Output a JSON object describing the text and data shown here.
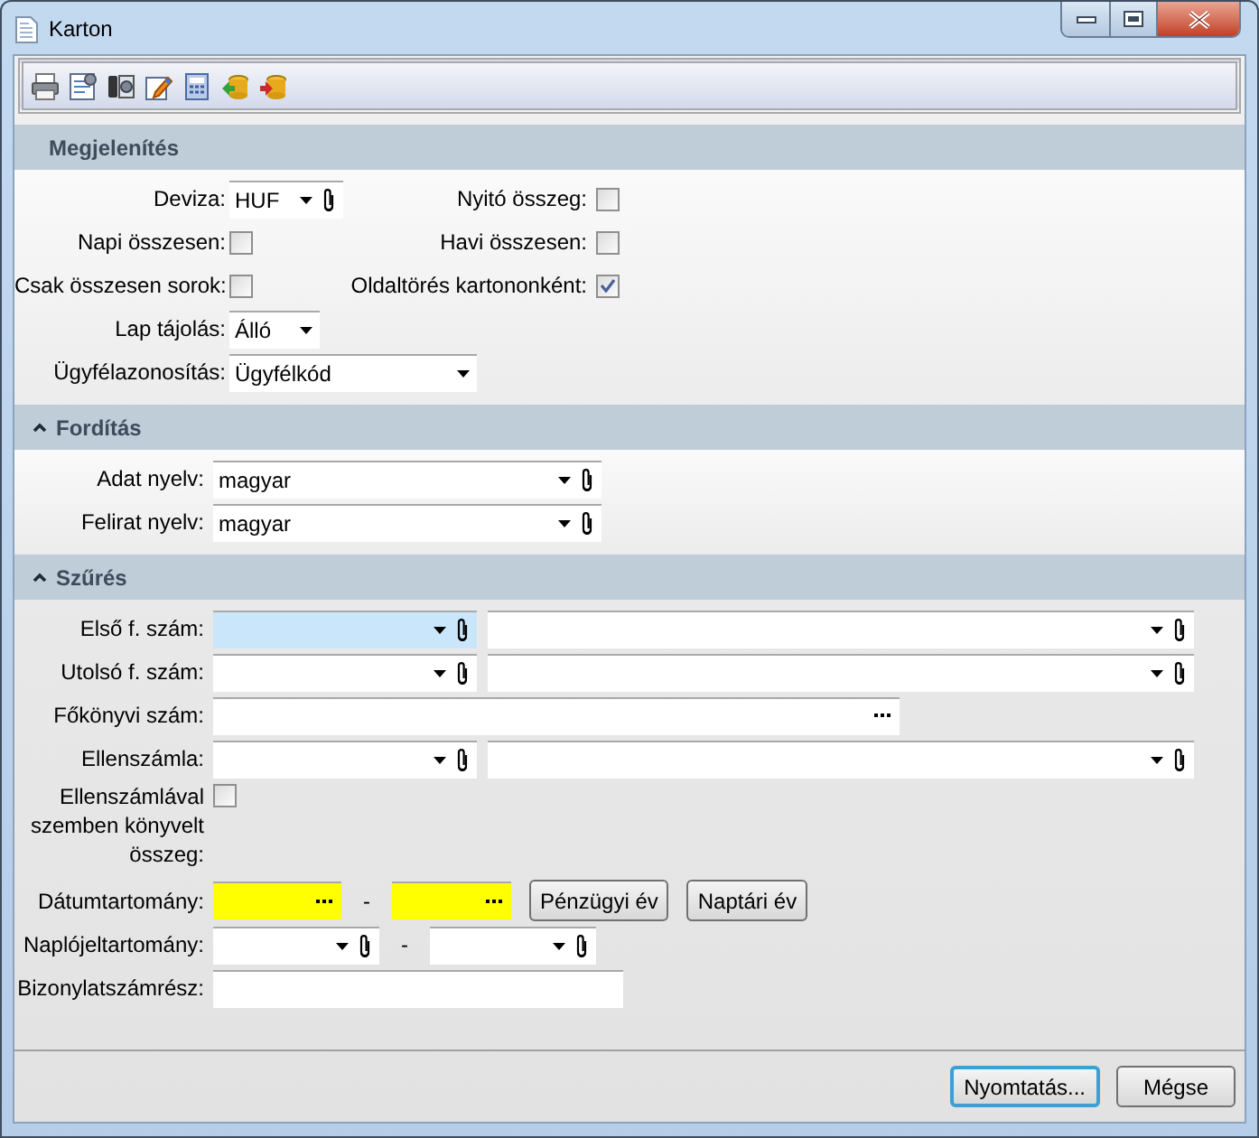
{
  "window": {
    "title": "Karton"
  },
  "sections": [
    {
      "title": "Megjelenítés",
      "collapsible": false,
      "rows": [
        [
          {
            "kind": "combo",
            "label": "Deviza:",
            "value": "HUF"
          },
          {
            "kind": "check",
            "label": "Nyitó összeg:",
            "checked": false
          }
        ],
        [
          {
            "kind": "check",
            "label": "Napi összesen:",
            "checked": false
          },
          {
            "kind": "check",
            "label": "Havi összesen:",
            "checked": false
          }
        ],
        [
          {
            "kind": "check",
            "label": "Csak összesen sorok:",
            "checked": false
          },
          {
            "kind": "check",
            "label": "Oldaltörés kartononként:",
            "checked": true
          }
        ],
        [
          {
            "kind": "select",
            "label": "Lap tájolás:",
            "value": "Álló"
          }
        ],
        [
          {
            "kind": "select",
            "label": "Ügyfélazonosítás:",
            "value": "Ügyfélkód"
          }
        ]
      ]
    },
    {
      "title": "Fordítás",
      "collapsible": true,
      "expanded": true,
      "rows": [
        {
          "label": "Adat nyelv:",
          "fields": [
            {
              "kind": "combo",
              "value": "magyar"
            }
          ]
        },
        {
          "label": "Felirat nyelv:",
          "fields": [
            {
              "kind": "combo",
              "value": "magyar"
            }
          ]
        }
      ]
    },
    {
      "title": "Szűrés",
      "collapsible": true,
      "expanded": true,
      "rows": [
        {
          "label": "Első f. szám:",
          "fields": [
            {
              "kind": "combo",
              "focused": true
            },
            {
              "kind": "combo",
              "focused": false
            }
          ]
        },
        {
          "label": "Utolsó f. szám:",
          "fields": [
            {
              "kind": "combo",
              "focused": false
            },
            {
              "kind": "combo",
              "focused": false
            }
          ]
        },
        {
          "label": "Főkönyvi szám:",
          "fields": [
            {
              "kind": "lookup"
            }
          ]
        },
        {
          "label": "Ellenszámla:",
          "fields": [
            {
              "kind": "combo",
              "focused": false
            },
            {
              "kind": "combo",
              "focused": false
            }
          ]
        },
        {
          "label": "Ellenszámlával szemben könyvelt összeg:",
          "fields": [
            {
              "kind": "check",
              "checked": false
            }
          ]
        },
        {
          "label": "Dátumtartomány:",
          "fields": [
            {
              "kind": "date",
              "required": true
            },
            {
              "kind": "dash",
              "text": "-"
            },
            {
              "kind": "date",
              "required": true
            },
            {
              "kind": "button",
              "label": "Pénzügyi év"
            },
            {
              "kind": "button",
              "label": "Naptári év"
            }
          ]
        },
        {
          "label": "Naplójeltartomány:",
          "fields": [
            {
              "kind": "combo",
              "focused": false
            },
            {
              "kind": "dash",
              "text": "-"
            },
            {
              "kind": "combo",
              "focused": false
            }
          ]
        },
        {
          "label": "Bizonylatszámrész:",
          "fields": [
            {
              "kind": "text"
            }
          ]
        }
      ]
    }
  ],
  "buttons": [
    {
      "label": "Nyomtatás...",
      "default": true
    },
    {
      "label": "Mégse",
      "default": false
    }
  ]
}
